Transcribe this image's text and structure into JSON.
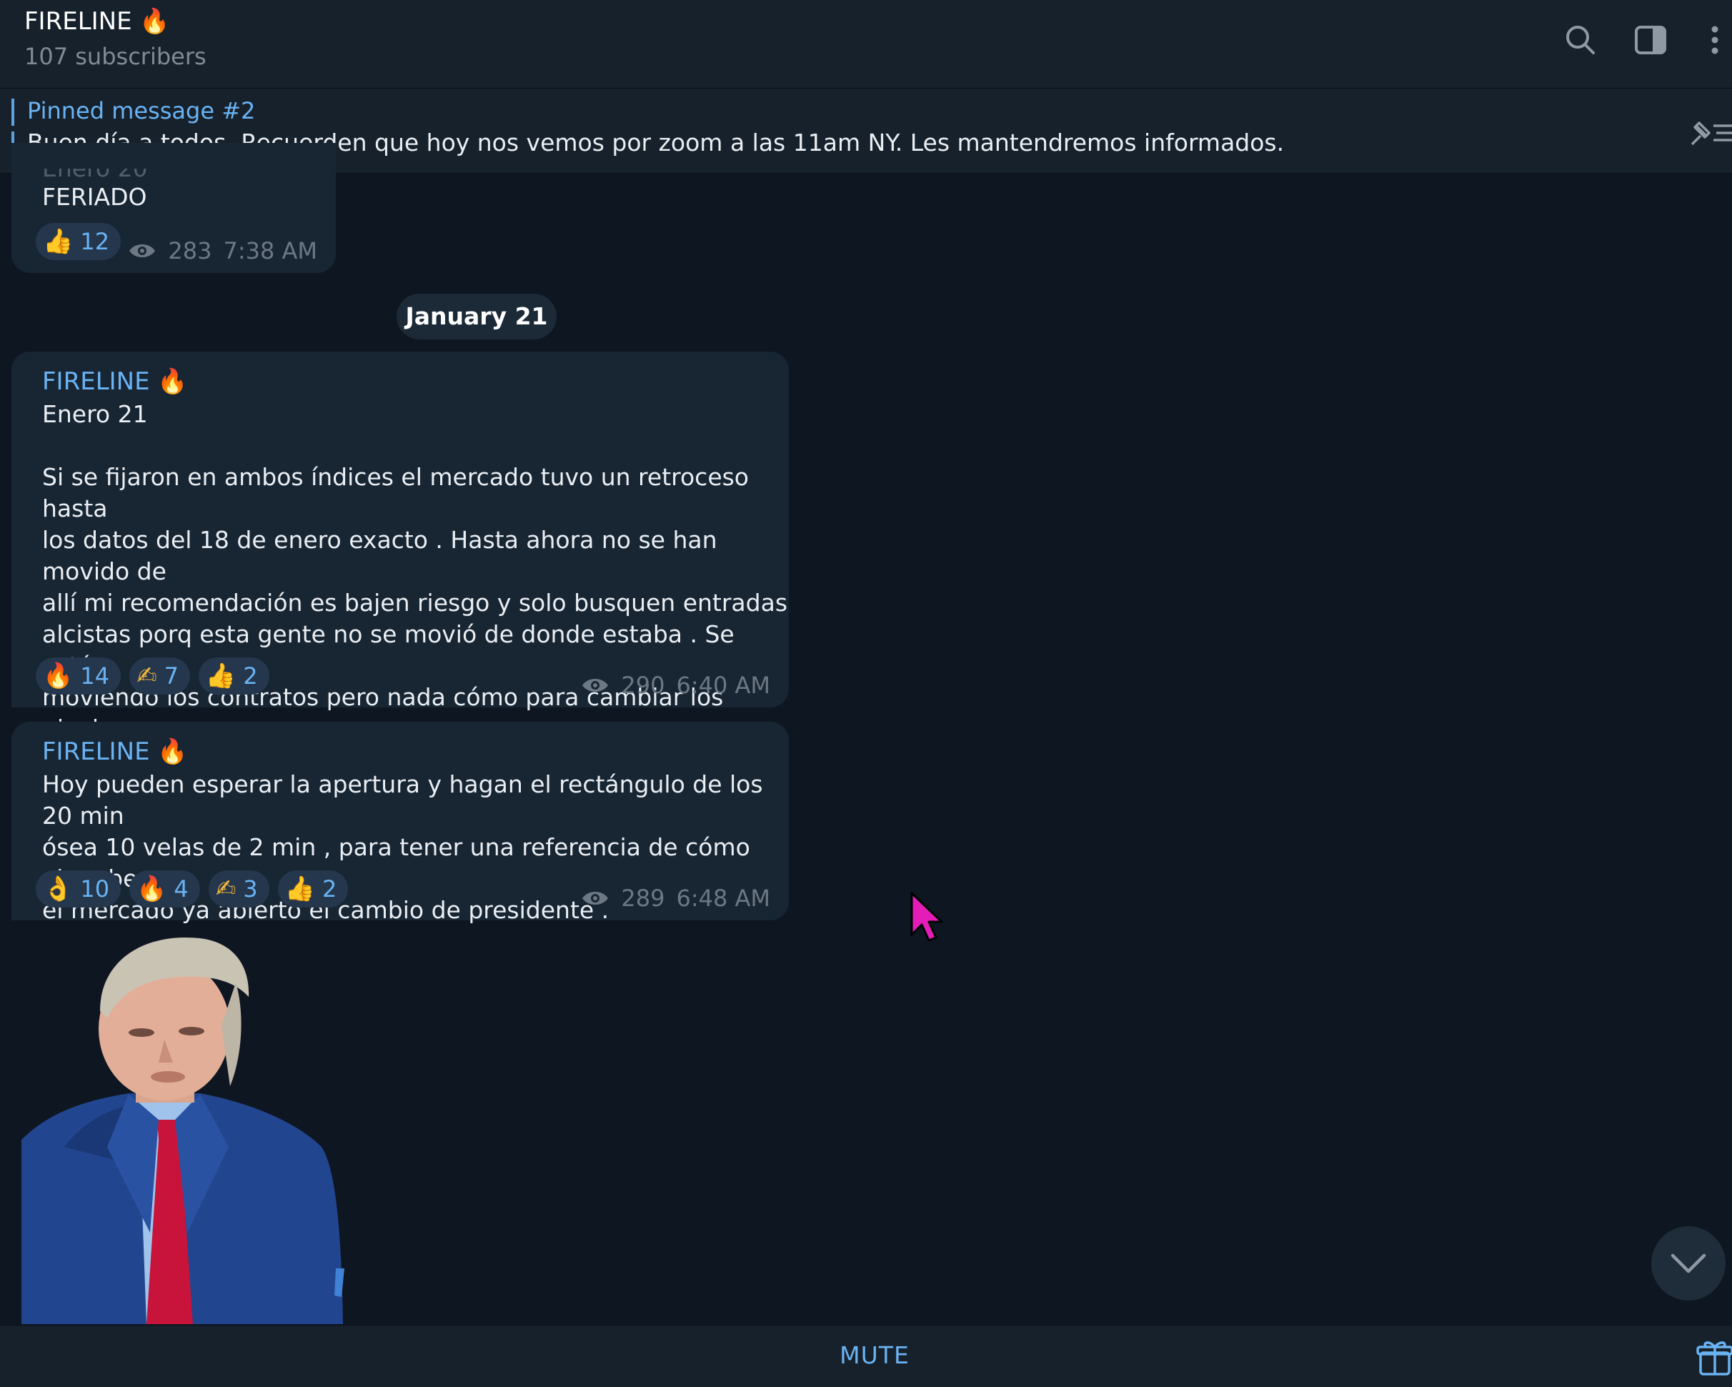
{
  "header": {
    "title": "FIRELINE 🔥",
    "subtitle": "107 subscribers",
    "icons": [
      "search-icon",
      "sidebar-toggle-icon",
      "more-vertical-icon"
    ]
  },
  "pinned": {
    "title": "Pinned message #2",
    "text": "Buen día a todos. Recuerden que hoy nos vemos por zoom a las 11am NY. Les mantendremos informados.",
    "icon": "pin-list-icon"
  },
  "messages": [
    {
      "partial_line": "Enero 20",
      "text": "FERIADO",
      "reactions": [
        {
          "emoji": "👍",
          "count": "12"
        }
      ],
      "views": "283",
      "time": "7:38 AM"
    },
    {
      "sender": "FIRELINE 🔥",
      "text": "Enero 21\n\nSi se fijaron en ambos índices el mercado tuvo un retroceso hasta\nlos datos del 18 de enero exacto . Hasta ahora no se han movido de\nallí mi recomendación es bajen riesgo y solo busquen entradas\nalcistas porq esta gente no se movió de donde estaba . Se están\nmoviendo los contratos pero nada cómo para cambiar los niveles,\nestaré pendiente por si ocurre un cambio .",
      "reactions": [
        {
          "emoji": "🔥",
          "count": "14"
        },
        {
          "emoji": "✍",
          "count": "7"
        },
        {
          "emoji": "👍",
          "count": "2"
        }
      ],
      "views": "290",
      "time": "6:40 AM"
    },
    {
      "sender": "FIRELINE 🔥",
      "text": "Hoy pueden esperar la apertura y hagan el rectángulo de los 20 min\nósea 10 velas de 2 min , para tener una referencia de cómo absorbe\nel mercado ya abierto el cambio de presidente .",
      "reactions": [
        {
          "emoji": "👌",
          "count": "10"
        },
        {
          "emoji": "🔥",
          "count": "4"
        },
        {
          "emoji": "✍",
          "count": "3"
        },
        {
          "emoji": "👍",
          "count": "2"
        }
      ],
      "views": "289",
      "time": "6:48 AM"
    }
  ],
  "date_separator": "January 21",
  "sticker": "man-in-blue-suit-sticker",
  "footer": {
    "mute_label": "MUTE",
    "gift_icon": "gift-icon"
  },
  "colors": {
    "background": "#0e1621",
    "panel": "#17212b",
    "bubble": "#182533",
    "accent": "#6ab3f3",
    "muted": "#6c7883"
  }
}
